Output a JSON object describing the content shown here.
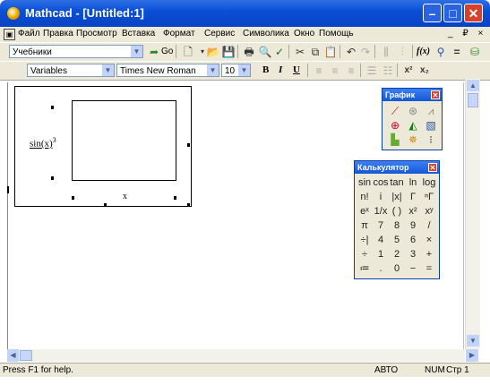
{
  "window": {
    "title": "Mathcad - [Untitled:1]"
  },
  "menu": [
    "Файл",
    "Правка",
    "Просмотр",
    "Вставка",
    "Формат",
    "Сервис",
    "Символика",
    "Окно",
    "Помощь"
  ],
  "menu_right": "_ ₽ ×",
  "toolbar": {
    "resources_value": "Учебники",
    "go_label": "Go",
    "zoom_text": "f(x)"
  },
  "format_bar": {
    "style_value": "Variables",
    "font_value": "Times New Roman",
    "size_value": "10",
    "bold": "B",
    "italic": "I",
    "underline": "U"
  },
  "worksheet": {
    "function_label": "sin(x)",
    "function_power": "3",
    "x_axis_label": "x"
  },
  "graph_palette": {
    "title": "График",
    "icons": [
      "xy-plot-icon",
      "polar-plot-icon",
      "surface-plot-icon",
      "contour-plot-icon",
      "3d-bar-icon",
      "scatter-3d-icon",
      "vector-field-icon",
      "3d-plot-wizard-icon",
      "data-points-icon"
    ]
  },
  "calculator_palette": {
    "title": "Калькулятор",
    "rows": [
      [
        "sin",
        "cos",
        "tan",
        "ln",
        "log"
      ],
      [
        "n!",
        "i",
        "|x|",
        "Γ",
        "ⁿΓ"
      ],
      [
        "eˣ",
        "1/x",
        "( )",
        "x²",
        "xʸ"
      ],
      [
        "π",
        "7",
        "8",
        "9",
        "/"
      ],
      [
        "÷|",
        "4",
        "5",
        "6",
        "×"
      ],
      [
        "÷",
        "1",
        "2",
        "3",
        "+"
      ],
      [
        "≔",
        ".",
        "0",
        "−",
        "="
      ]
    ]
  },
  "status": {
    "help": "Press F1 for help.",
    "mode": "АВТО",
    "num": "NUM",
    "page": "Стр 1"
  },
  "colors": {
    "titlebar": "#0a4fd6",
    "chrome": "#ece9d8",
    "close": "#d5412b"
  }
}
